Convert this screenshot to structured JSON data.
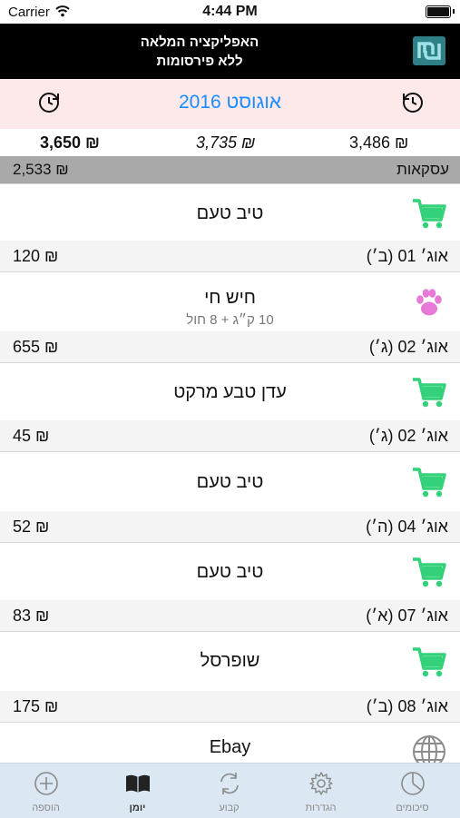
{
  "status_bar": {
    "carrier": "Carrier",
    "time": "4:44 PM"
  },
  "banner": {
    "line1": "האפליקציה המלאה",
    "line2": "ללא פירסומות"
  },
  "month_bar": {
    "title": "אוגוסט 2016"
  },
  "totals": {
    "left": "3,650 ₪",
    "center": "3,735 ₪",
    "right": "3,486 ₪"
  },
  "category": {
    "label": "עסקאות",
    "amount": "2,533 ₪"
  },
  "transactions": [
    {
      "name": "טיב טעם",
      "sub": "",
      "icon": "cart-icon",
      "amount": "120 ₪",
      "date": "אוג׳ 01 (ב׳)"
    },
    {
      "name": "חיש חי",
      "sub": "10 ק״ג + 8 חול",
      "icon": "paw-icon",
      "amount": "655 ₪",
      "date": "אוג׳ 02 (ג׳)"
    },
    {
      "name": "עדן טבע מרקט",
      "sub": "",
      "icon": "cart-icon",
      "amount": "45 ₪",
      "date": "אוג׳ 02 (ג׳)"
    },
    {
      "name": "טיב טעם",
      "sub": "",
      "icon": "cart-icon",
      "amount": "52 ₪",
      "date": "אוג׳ 04 (ה׳)"
    },
    {
      "name": "טיב טעם",
      "sub": "",
      "icon": "cart-icon",
      "amount": "83 ₪",
      "date": "אוג׳ 07 (א׳)"
    },
    {
      "name": "שופרסל",
      "sub": "",
      "icon": "cart-icon",
      "amount": "175 ₪",
      "date": "אוג׳ 08 (ב׳)"
    },
    {
      "name": "Ebay",
      "sub": "",
      "icon": "globe-icon",
      "amount": "",
      "date": ""
    }
  ],
  "tabs": [
    {
      "label": "הוספה",
      "icon": "plus-circle-icon"
    },
    {
      "label": "יומן",
      "icon": "book-icon"
    },
    {
      "label": "קבוע",
      "icon": "refresh-icon"
    },
    {
      "label": "הגדרות",
      "icon": "gear-icon"
    },
    {
      "label": "סיכומים",
      "icon": "pie-chart-icon"
    }
  ],
  "colors": {
    "accent": "#1a8cff",
    "cart": "#33d17a",
    "paw": "#e67ad6",
    "month_bg": "#fde9e9",
    "tab_bg": "#dbe8f3"
  }
}
